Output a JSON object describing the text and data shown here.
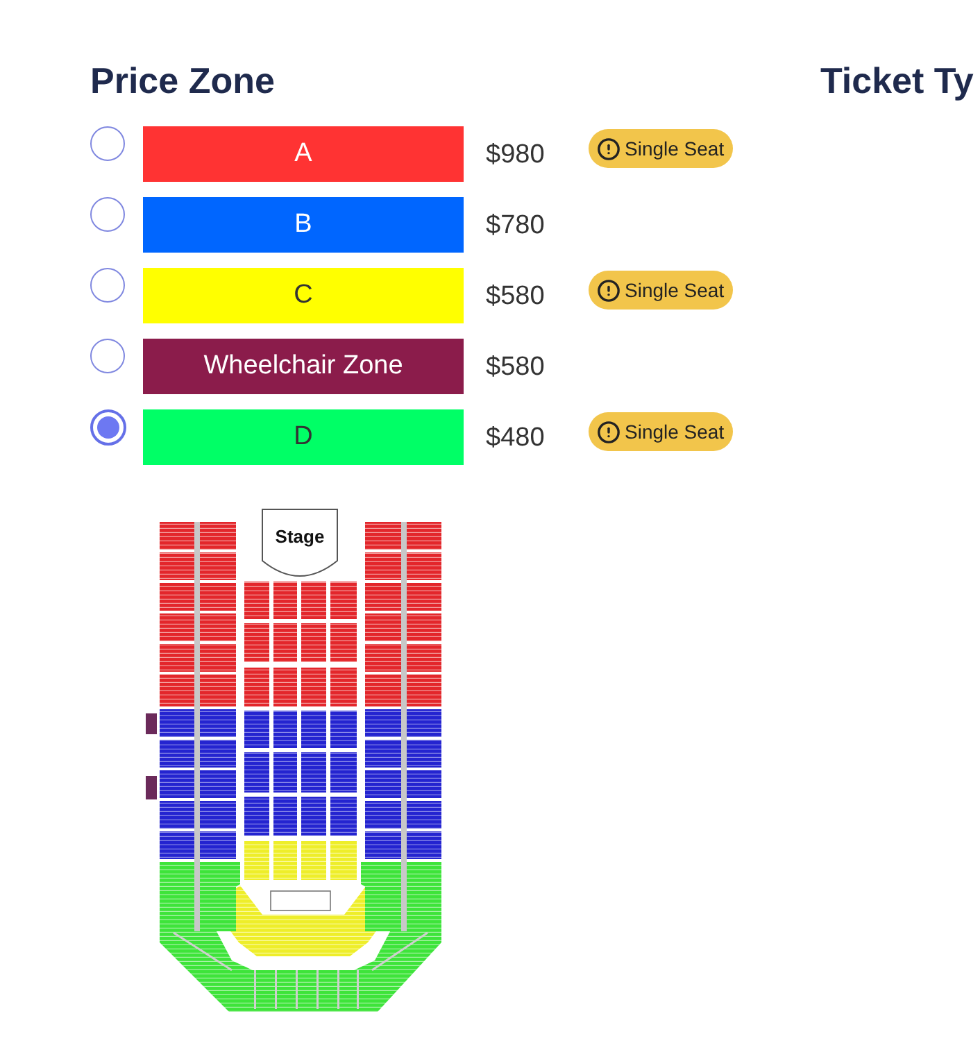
{
  "price_zone": {
    "title": "Price Zone",
    "zones": [
      {
        "label": "A",
        "color": "#ff3333",
        "price": "$980",
        "badge": "Single Seat",
        "selected": false
      },
      {
        "label": "B",
        "color": "#0066ff",
        "price": "$780",
        "selected": false
      },
      {
        "label": "C",
        "color": "#ffff00",
        "price": "$580",
        "badge": "Single Seat",
        "selected": false
      },
      {
        "label": "Wheelchair Zone",
        "color": "#8b1c4b",
        "price": "$580",
        "selected": false
      },
      {
        "label": "D",
        "color": "#00ff66",
        "price": "$480",
        "badge": "Single Seat",
        "selected": true
      }
    ]
  },
  "seat_map": {
    "stage_label": "Stage"
  },
  "ticket_type": {
    "title": "Ticket Ty"
  }
}
